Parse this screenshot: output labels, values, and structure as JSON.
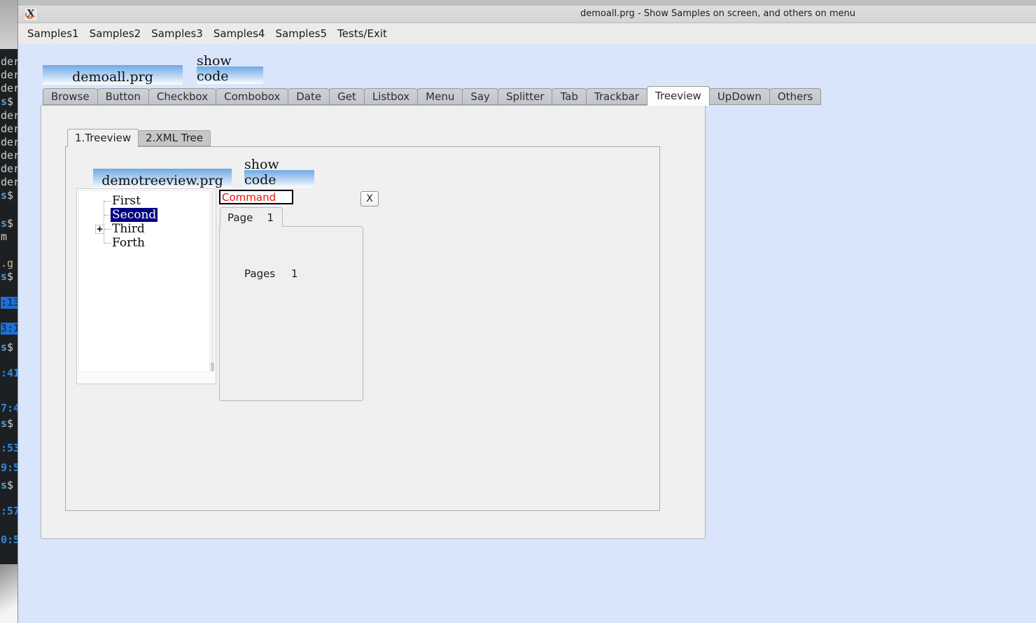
{
  "window": {
    "title": "demoall.prg - Show Samples on screen, and others on menu",
    "icon_glyph": "X",
    "menu": [
      "Samples1",
      "Samples2",
      "Samples3",
      "Samples4",
      "Samples5",
      "Tests/Exit"
    ]
  },
  "main": {
    "header_label": "demoall.prg",
    "show_code_label": "show code",
    "tabs": [
      "Browse",
      "Button",
      "Checkbox",
      "Combobox",
      "Date",
      "Get",
      "Listbox",
      "Menu",
      "Say",
      "Splitter",
      "Tab",
      "Trackbar",
      "Treeview",
      "UpDown",
      "Others"
    ],
    "selected_tab": "Treeview"
  },
  "treeview_page": {
    "tabs": [
      "1.Treeview",
      "2.XML Tree"
    ],
    "selected_tab": "1.Treeview",
    "header_label": "demotreeview.prg",
    "show_code_label": "show code",
    "command_value": "Command",
    "x_button_label": "X",
    "tree": {
      "items": [
        {
          "label": "First",
          "selected": false
        },
        {
          "label": "Second",
          "selected": true
        },
        {
          "label": "Third",
          "selected": false,
          "expandable": true
        },
        {
          "label": "Forth",
          "selected": false
        }
      ],
      "expand_glyph": "+"
    },
    "page_tab": {
      "label": "Page",
      "value": "1"
    },
    "page_content": {
      "label": "Pages",
      "value": "1"
    }
  },
  "colors": {
    "selection": "#000080",
    "command_text": "#e8100c",
    "header_gradient_top": "#6fa9e5",
    "window_body": "#d9e5fa",
    "terminal_bg": "#1d2022",
    "terminal_time": "#2f86df",
    "terminal_highlight": "#1e70d3"
  },
  "terminal": {
    "lines": [
      {
        "a": "der"
      },
      {
        "a": "der"
      },
      {
        "a": "der"
      },
      {
        "a": "s",
        "b": "$"
      },
      {
        "a": "der"
      },
      {
        "a": "der"
      },
      {
        "a": "der"
      },
      {
        "a": "der"
      },
      {
        "a": "der"
      },
      {
        "a": "der"
      },
      {
        "a": "s",
        "b": "$"
      },
      {
        "a": "s",
        "b": "$"
      },
      {
        "a": "m"
      },
      {
        "a": ".g"
      },
      {
        "a": "s",
        "b": "$"
      },
      {
        "a": ":13"
      },
      {
        "a": "3:1"
      },
      {
        "a": "s",
        "b": "$"
      },
      {
        "a": ":41"
      },
      {
        "a": "7:4"
      },
      {
        "a": "s",
        "b": "$"
      },
      {
        "a": ":53"
      },
      {
        "a": "9:5"
      },
      {
        "a": "s",
        "b": "$"
      },
      {
        "a": ":57"
      },
      {
        "a": "0:5"
      }
    ]
  }
}
